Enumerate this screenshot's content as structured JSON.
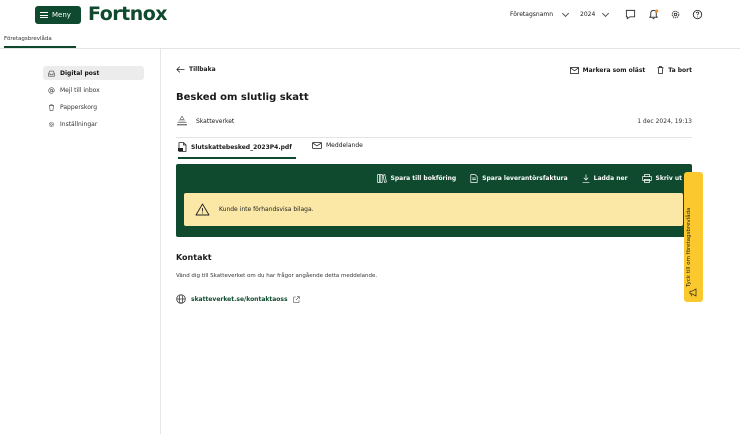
{
  "topbar": {
    "menu_label": "Meny",
    "logo_text": "Fortnox",
    "company_label": "Företagsnamn",
    "year_label": "2024",
    "notification_dot_color": "#f28c28"
  },
  "subnav": {
    "tab_label": "Företagsbrevlåda"
  },
  "sidebar": {
    "items": [
      {
        "label": "Digital post",
        "icon": "inbox-icon",
        "active": true
      },
      {
        "label": "Mejl till inbox",
        "icon": "at-icon"
      },
      {
        "label": "Papperskorg",
        "icon": "trash-icon"
      },
      {
        "label": "Inställningar",
        "icon": "gear-icon"
      }
    ]
  },
  "message": {
    "back_label": "Tillbaka",
    "mark_unread_label": "Markera som oläst",
    "delete_label": "Ta bort",
    "title": "Besked om slutlig skatt",
    "sender": "Skatteverket",
    "date": "1 dec 2024, 19:13",
    "tabs": [
      {
        "label": "Slutskattebesked_2023P4.pdf",
        "icon": "pdf-icon"
      },
      {
        "label": "Meddelande",
        "icon": "mail-icon"
      }
    ]
  },
  "viewer": {
    "actions": [
      {
        "label": "Spara till bokföring",
        "icon": "book-icon"
      },
      {
        "label": "Spara leverantörsfaktura",
        "icon": "invoice-icon"
      },
      {
        "label": "Ladda ner",
        "icon": "download-icon"
      },
      {
        "label": "Skriv ut",
        "icon": "printer-icon"
      }
    ],
    "warning_text": "Kunde inte förhandsvisa bilaga."
  },
  "contact": {
    "heading": "Kontakt",
    "text": "Vänd dig till Skatteverket om du har frågor angående detta meddelande.",
    "link": "skatteverket.se/kontaktaoss"
  },
  "feedback": {
    "label": "Tyck till om företagsbrevlåda"
  },
  "colors": {
    "brand_green": "#0f4a2e",
    "warning_bg": "#fbe8a6",
    "feedback_bg": "#fbc92d"
  }
}
